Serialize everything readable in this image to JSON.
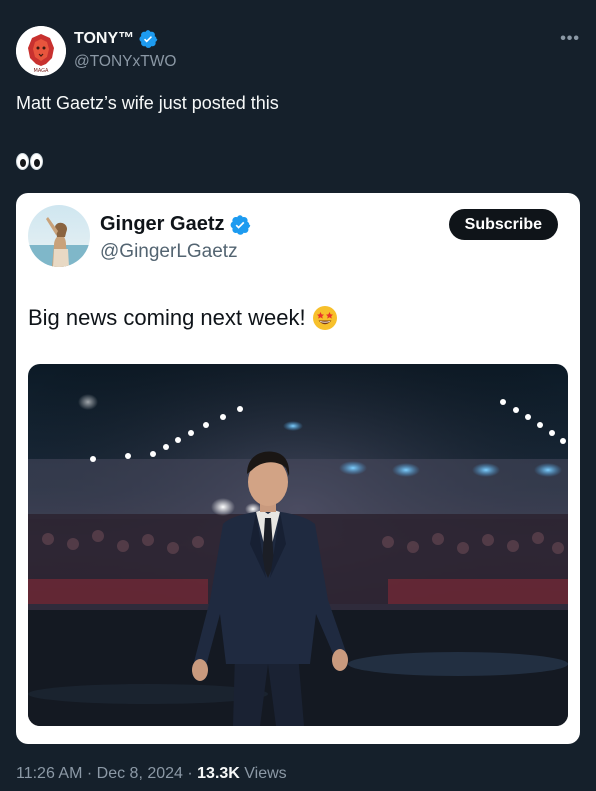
{
  "author": {
    "display_name": "TONY™",
    "handle": "@TONYxTWO",
    "verified": true,
    "avatar_icon": "lion-logo-avatar"
  },
  "tweet": {
    "text": "Matt Gaetz’s wife just posted this",
    "emoji": "eyes-emoji"
  },
  "quoted": {
    "display_name": "Ginger Gaetz",
    "handle": "@GingerLGaetz",
    "verified": true,
    "subscribe_label": "Subscribe",
    "text": "Big news coming next week!",
    "emoji": "star-struck-emoji"
  },
  "meta": {
    "time": "11:26 AM",
    "separator1": " · ",
    "date": "Dec 8, 2024",
    "separator2": " · ",
    "views_count": "13.3K",
    "views_label": " Views"
  },
  "colors": {
    "background": "#15202b",
    "verified_blue": "#1d9bf0",
    "card_background": "#ffffff"
  }
}
